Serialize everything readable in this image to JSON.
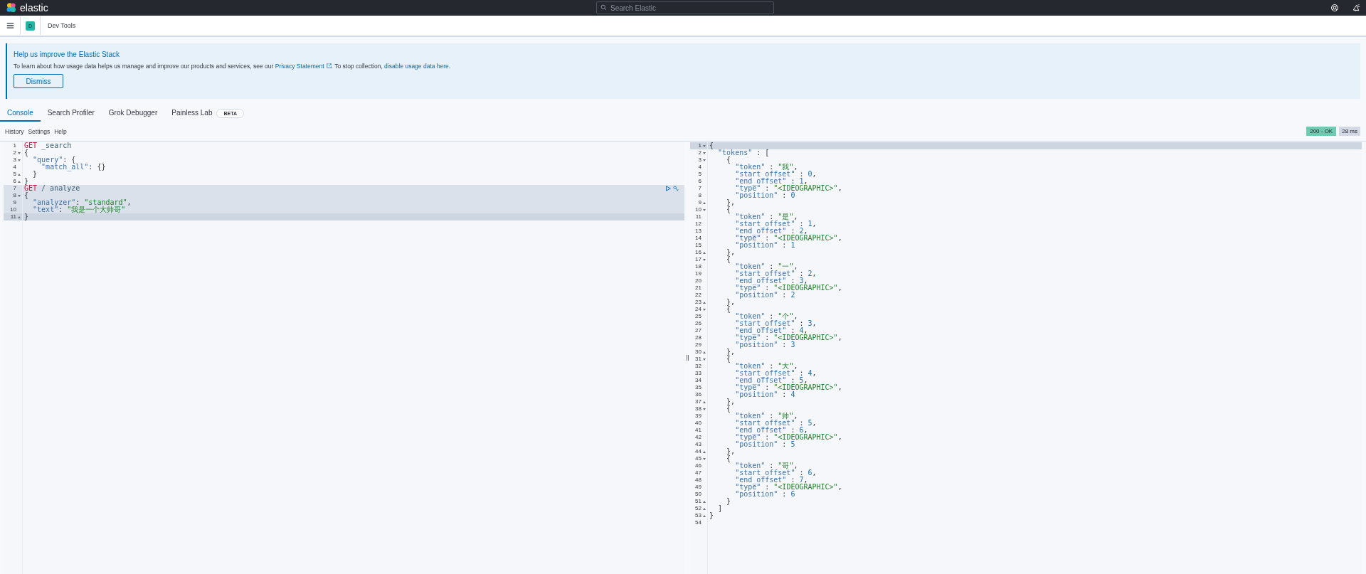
{
  "top_bar": {
    "brand": "elastic",
    "search": {
      "placeholder": "Search Elastic"
    }
  },
  "header": {
    "space_initial": "D",
    "breadcrumb": "Dev Tools"
  },
  "banner": {
    "title": "Help us improve the Elastic Stack",
    "text_parts": [
      {
        "kind": "text",
        "text": "To learn about how usage data helps us manage and improve our products and services, see our "
      },
      {
        "kind": "link",
        "text": "Privacy Statement",
        "external": true
      },
      {
        "kind": "text",
        "text": ". To stop collection, "
      },
      {
        "kind": "link",
        "text": "disable usage data here",
        "external": false
      },
      {
        "kind": "text",
        "text": "."
      }
    ],
    "button": "Dismiss"
  },
  "tabs": [
    {
      "label": "Console",
      "selected": true
    },
    {
      "label": "Search Profiler",
      "selected": false
    },
    {
      "label": "Grok Debugger",
      "selected": false
    },
    {
      "label": "Painless Lab",
      "selected": false,
      "badge": "BETA"
    }
  ],
  "menu": [
    "History",
    "Settings",
    "Help"
  ],
  "status": {
    "code": "200 - OK",
    "time": "28 ms"
  },
  "request_editor": {
    "lines": [
      {
        "n": "1",
        "kind": "plain",
        "text": "GET _search",
        "in_request": false,
        "cursor": false
      },
      {
        "n": "2",
        "kind": "fold-start",
        "text": "{",
        "in_request": false,
        "cursor": false
      },
      {
        "n": "3",
        "kind": "fold-start",
        "text": "  \"query\": {",
        "in_request": false,
        "cursor": false
      },
      {
        "n": "4",
        "kind": "plain",
        "text": "    \"match_all\": {}",
        "in_request": false,
        "cursor": false
      },
      {
        "n": "5",
        "kind": "fold-end",
        "text": "  }",
        "in_request": false,
        "cursor": false
      },
      {
        "n": "6",
        "kind": "fold-end",
        "text": "}",
        "in_request": false,
        "cursor": false
      },
      {
        "n": "7",
        "kind": "plain",
        "text": "GET /_analyze",
        "in_request": true,
        "cursor": false
      },
      {
        "n": "8",
        "kind": "fold-start",
        "text": "{",
        "in_request": true,
        "cursor": false
      },
      {
        "n": "9",
        "kind": "plain",
        "text": "  \"analyzer\": \"standard\",",
        "in_request": true,
        "cursor": false
      },
      {
        "n": "10",
        "kind": "plain",
        "text": "  \"text\": \"我是一个大帅哥\"",
        "in_request": true,
        "cursor": false
      },
      {
        "n": "11",
        "kind": "fold-end",
        "text": "}",
        "in_request": true,
        "cursor": true
      }
    ]
  },
  "response_editor": {
    "lines": [
      {
        "n": "1",
        "kind": "fold-start",
        "text": "{",
        "cursor": true
      },
      {
        "n": "2",
        "kind": "fold-start",
        "text": "  \"tokens\" : [",
        "cursor": false
      },
      {
        "n": "3",
        "kind": "fold-start",
        "text": "    {",
        "cursor": false
      },
      {
        "n": "4",
        "kind": "plain",
        "text": "      \"token\" : \"我\",",
        "cursor": false
      },
      {
        "n": "5",
        "kind": "plain",
        "text": "      \"start_offset\" : 0,",
        "cursor": false
      },
      {
        "n": "6",
        "kind": "plain",
        "text": "      \"end_offset\" : 1,",
        "cursor": false
      },
      {
        "n": "7",
        "kind": "plain",
        "text": "      \"type\" : \"<IDEOGRAPHIC>\",",
        "cursor": false
      },
      {
        "n": "8",
        "kind": "plain",
        "text": "      \"position\" : 0",
        "cursor": false
      },
      {
        "n": "9",
        "kind": "fold-end",
        "text": "    },",
        "cursor": false
      },
      {
        "n": "10",
        "kind": "fold-start",
        "text": "    {",
        "cursor": false
      },
      {
        "n": "11",
        "kind": "plain",
        "text": "      \"token\" : \"是\",",
        "cursor": false
      },
      {
        "n": "12",
        "kind": "plain",
        "text": "      \"start_offset\" : 1,",
        "cursor": false
      },
      {
        "n": "13",
        "kind": "plain",
        "text": "      \"end_offset\" : 2,",
        "cursor": false
      },
      {
        "n": "14",
        "kind": "plain",
        "text": "      \"type\" : \"<IDEOGRAPHIC>\",",
        "cursor": false
      },
      {
        "n": "15",
        "kind": "plain",
        "text": "      \"position\" : 1",
        "cursor": false
      },
      {
        "n": "16",
        "kind": "fold-end",
        "text": "    },",
        "cursor": false
      },
      {
        "n": "17",
        "kind": "fold-start",
        "text": "    {",
        "cursor": false
      },
      {
        "n": "18",
        "kind": "plain",
        "text": "      \"token\" : \"一\",",
        "cursor": false
      },
      {
        "n": "19",
        "kind": "plain",
        "text": "      \"start_offset\" : 2,",
        "cursor": false
      },
      {
        "n": "20",
        "kind": "plain",
        "text": "      \"end_offset\" : 3,",
        "cursor": false
      },
      {
        "n": "21",
        "kind": "plain",
        "text": "      \"type\" : \"<IDEOGRAPHIC>\",",
        "cursor": false
      },
      {
        "n": "22",
        "kind": "plain",
        "text": "      \"position\" : 2",
        "cursor": false
      },
      {
        "n": "23",
        "kind": "fold-end",
        "text": "    },",
        "cursor": false
      },
      {
        "n": "24",
        "kind": "fold-start",
        "text": "    {",
        "cursor": false
      },
      {
        "n": "25",
        "kind": "plain",
        "text": "      \"token\" : \"个\",",
        "cursor": false
      },
      {
        "n": "26",
        "kind": "plain",
        "text": "      \"start_offset\" : 3,",
        "cursor": false
      },
      {
        "n": "27",
        "kind": "plain",
        "text": "      \"end_offset\" : 4,",
        "cursor": false
      },
      {
        "n": "28",
        "kind": "plain",
        "text": "      \"type\" : \"<IDEOGRAPHIC>\",",
        "cursor": false
      },
      {
        "n": "29",
        "kind": "plain",
        "text": "      \"position\" : 3",
        "cursor": false
      },
      {
        "n": "30",
        "kind": "fold-end",
        "text": "    },",
        "cursor": false
      },
      {
        "n": "31",
        "kind": "fold-start",
        "text": "    {",
        "cursor": false
      },
      {
        "n": "32",
        "kind": "plain",
        "text": "      \"token\" : \"大\",",
        "cursor": false
      },
      {
        "n": "33",
        "kind": "plain",
        "text": "      \"start_offset\" : 4,",
        "cursor": false
      },
      {
        "n": "34",
        "kind": "plain",
        "text": "      \"end_offset\" : 5,",
        "cursor": false
      },
      {
        "n": "35",
        "kind": "plain",
        "text": "      \"type\" : \"<IDEOGRAPHIC>\",",
        "cursor": false
      },
      {
        "n": "36",
        "kind": "plain",
        "text": "      \"position\" : 4",
        "cursor": false
      },
      {
        "n": "37",
        "kind": "fold-end",
        "text": "    },",
        "cursor": false
      },
      {
        "n": "38",
        "kind": "fold-start",
        "text": "    {",
        "cursor": false
      },
      {
        "n": "39",
        "kind": "plain",
        "text": "      \"token\" : \"帅\",",
        "cursor": false
      },
      {
        "n": "40",
        "kind": "plain",
        "text": "      \"start_offset\" : 5,",
        "cursor": false
      },
      {
        "n": "41",
        "kind": "plain",
        "text": "      \"end_offset\" : 6,",
        "cursor": false
      },
      {
        "n": "42",
        "kind": "plain",
        "text": "      \"type\" : \"<IDEOGRAPHIC>\",",
        "cursor": false
      },
      {
        "n": "43",
        "kind": "plain",
        "text": "      \"position\" : 5",
        "cursor": false
      },
      {
        "n": "44",
        "kind": "fold-end",
        "text": "    },",
        "cursor": false
      },
      {
        "n": "45",
        "kind": "fold-start",
        "text": "    {",
        "cursor": false
      },
      {
        "n": "46",
        "kind": "plain",
        "text": "      \"token\" : \"哥\",",
        "cursor": false
      },
      {
        "n": "47",
        "kind": "plain",
        "text": "      \"start_offset\" : 6,",
        "cursor": false
      },
      {
        "n": "48",
        "kind": "plain",
        "text": "      \"end_offset\" : 7,",
        "cursor": false
      },
      {
        "n": "49",
        "kind": "plain",
        "text": "      \"type\" : \"<IDEOGRAPHIC>\",",
        "cursor": false
      },
      {
        "n": "50",
        "kind": "plain",
        "text": "      \"position\" : 6",
        "cursor": false
      },
      {
        "n": "51",
        "kind": "fold-end",
        "text": "    }",
        "cursor": false
      },
      {
        "n": "52",
        "kind": "fold-end",
        "text": "  ]",
        "cursor": false
      },
      {
        "n": "53",
        "kind": "fold-end",
        "text": "}",
        "cursor": false
      },
      {
        "n": "54",
        "kind": "plain",
        "cursor": false
      }
    ]
  }
}
